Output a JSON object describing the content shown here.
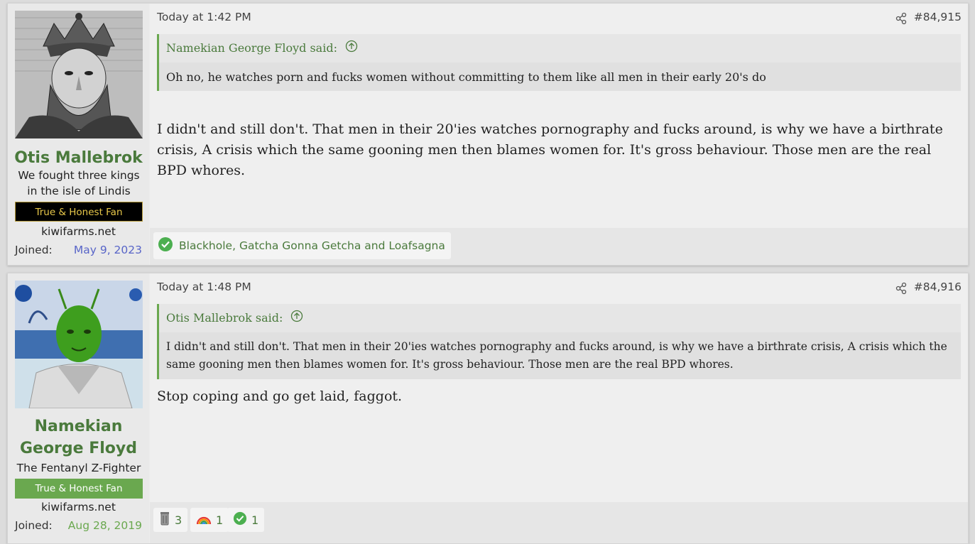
{
  "posts": [
    {
      "user": {
        "name": "Otis Mallebrok",
        "title": "We fought three kings in the isle of Lindis",
        "banner": "True & Honest Fan",
        "site": "kiwifarms.net",
        "joined_label": "Joined:",
        "joined_date": "May 9, 2023"
      },
      "date": "Today at 1:42 PM",
      "number": "#84,915",
      "quote": {
        "author": "Namekian George Floyd said:",
        "text": "Oh no, he watches porn and fucks women without committing to them like all men in their early 20's do"
      },
      "message": "I didn't and still don't. That men in their 20'ies watches pornography and fucks around, is why we have a birthrate crisis, A crisis which the same gooning men then blames women for. It's gross behaviour. Those men are the real BPD whores.",
      "reactions_text": "Blackhole, Gatcha Gonna Getcha and Loafsagna"
    },
    {
      "user": {
        "name": "Namekian George Floyd",
        "title": "The Fentanyl Z-Fighter",
        "banner": "True & Honest Fan",
        "site": "kiwifarms.net",
        "joined_label": "Joined:",
        "joined_date": "Aug 28, 2019"
      },
      "date": "Today at 1:48 PM",
      "number": "#84,916",
      "quote": {
        "author": "Otis Mallebrok said:",
        "text": "I didn't and still don't. That men in their 20'ies watches pornography and fucks around, is why we have a birthrate crisis, A crisis which the same gooning men then blames women for. It's gross behaviour. Those men are the real BPD whores."
      },
      "message": "Stop coping and go get laid, faggot.",
      "reactions": [
        {
          "icon": "trash-can-icon",
          "count": "3"
        },
        {
          "icon": "rainbow-icon",
          "count": "1"
        },
        {
          "icon": "check-icon",
          "count": "1"
        }
      ]
    }
  ],
  "colors": {
    "username": "#4a7a3c",
    "joined_date_1": "#5865c8",
    "joined_date_2": "#6aa84f",
    "banner_green": "#6aa84f",
    "quote_border": "#6aa84f"
  }
}
